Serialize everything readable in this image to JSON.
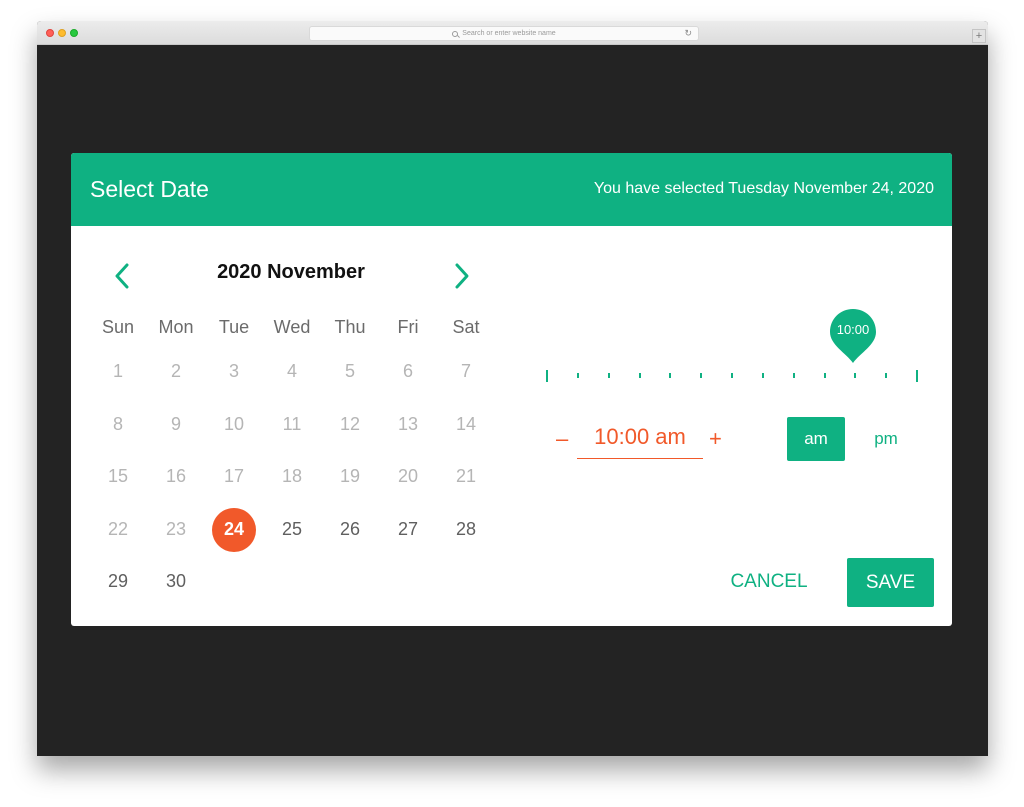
{
  "browser": {
    "url_placeholder": "Search or enter website name",
    "newtab_label": "+"
  },
  "dialog": {
    "title": "Select Date",
    "selected_text": "You have selected Tuesday November 24, 2020"
  },
  "calendar": {
    "month_label": "2020 November",
    "weekdays": [
      "Sun",
      "Mon",
      "Tue",
      "Wed",
      "Thu",
      "Fri",
      "Sat"
    ],
    "weeks": [
      [
        "1",
        "2",
        "3",
        "4",
        "5",
        "6",
        "7"
      ],
      [
        "8",
        "9",
        "10",
        "11",
        "12",
        "13",
        "14"
      ],
      [
        "15",
        "16",
        "17",
        "18",
        "19",
        "20",
        "21"
      ],
      [
        "22",
        "23",
        "24",
        "25",
        "26",
        "27",
        "28"
      ],
      [
        "29",
        "30",
        "",
        "",
        "",
        "",
        ""
      ]
    ],
    "selected_day": "24",
    "first_available_day": 24
  },
  "time": {
    "bubble_label": "10:00",
    "minus_label": "–",
    "value": "10:00 am",
    "plus_label": "+",
    "am_label": "am",
    "pm_label": "pm",
    "selected_period": "am",
    "slider_tick_count": 13,
    "slider_selected_tick": 10
  },
  "actions": {
    "cancel_label": "CANCEL",
    "save_label": "SAVE"
  },
  "colors": {
    "accent": "#0fb182",
    "highlight": "#f1592a",
    "background": "#232323"
  }
}
